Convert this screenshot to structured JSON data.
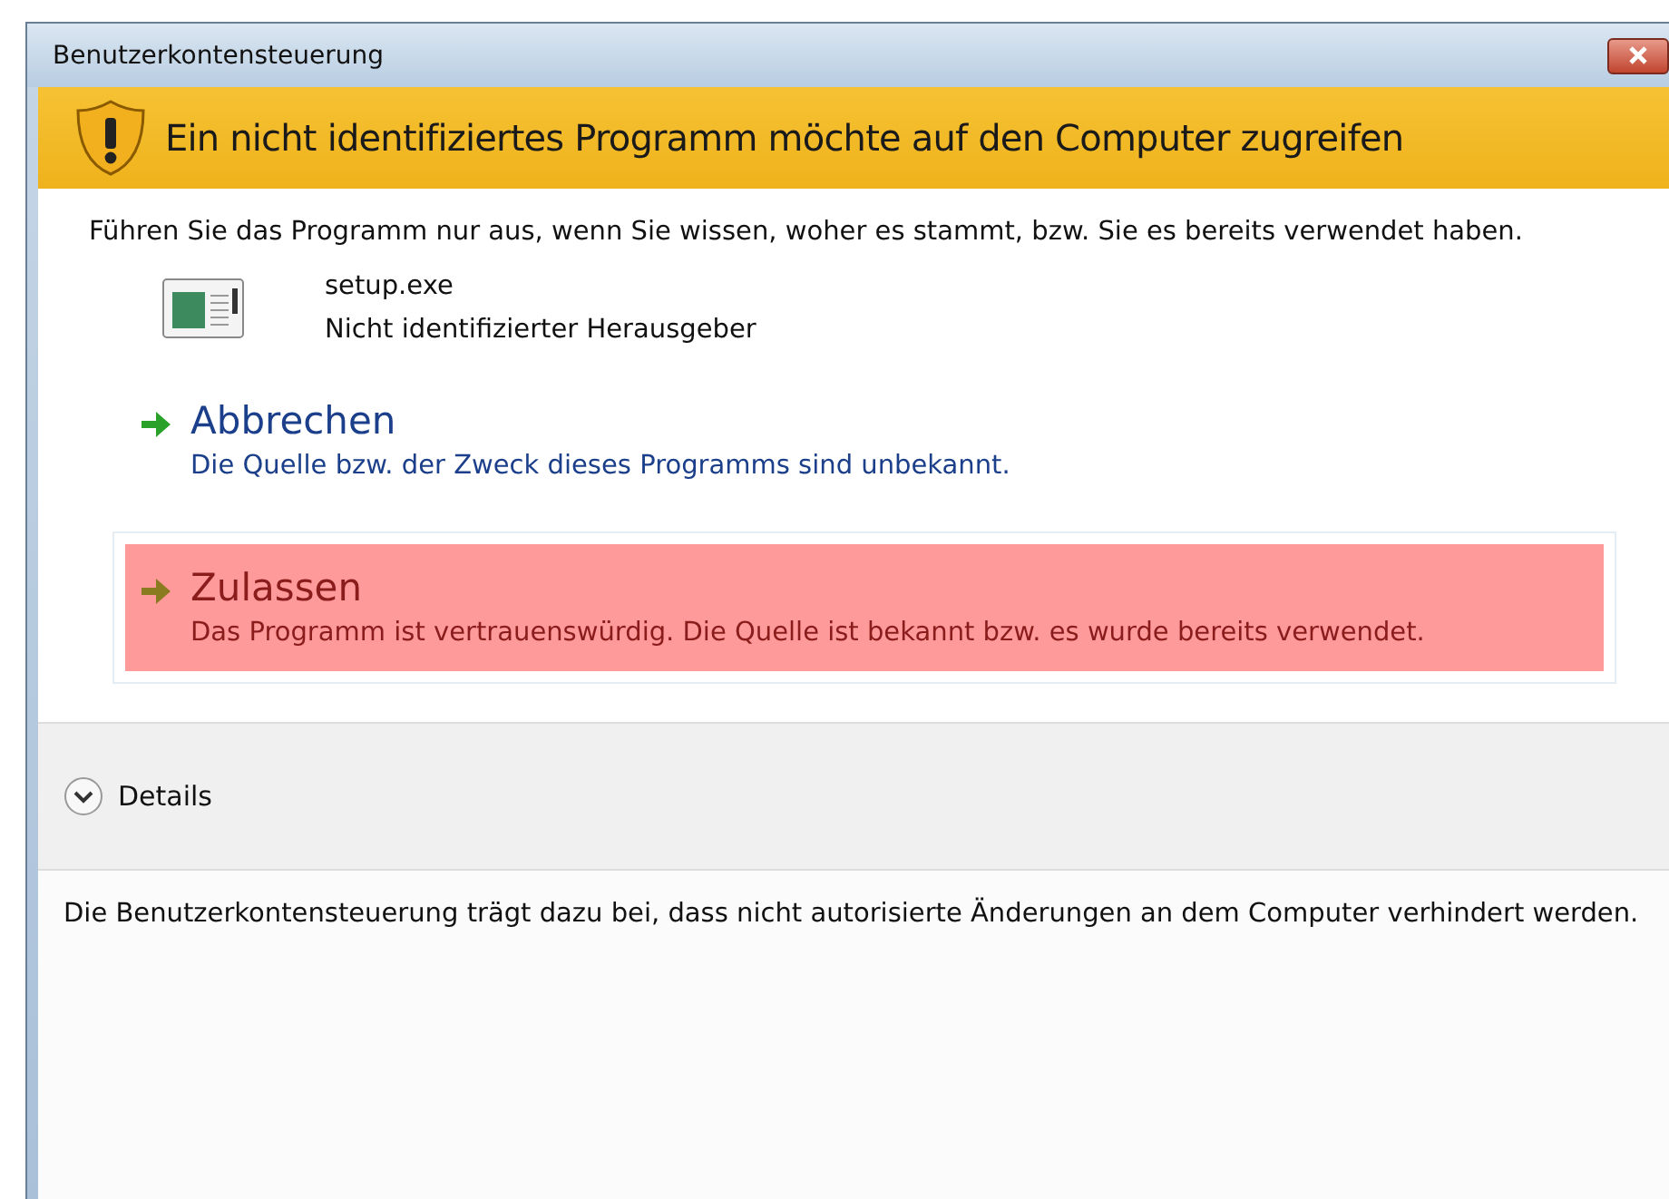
{
  "window": {
    "title": "Benutzerkontensteuerung"
  },
  "banner": {
    "text": "Ein nicht identifiziertes Programm möchte auf den Computer zugreifen"
  },
  "intro": "Führen Sie das Programm nur aus, wenn Sie wissen, woher es stammt, bzw. Sie es bereits verwendet haben.",
  "program": {
    "name": "setup.exe",
    "publisher": "Nicht identifizierter Herausgeber"
  },
  "options": [
    {
      "title": "Abbrechen",
      "description": "Die Quelle bzw. der Zweck dieses Programms sind unbekannt.",
      "selected": false
    },
    {
      "title": "Zulassen",
      "description": "Das Programm ist vertrauenswürdig. Die Quelle ist bekannt bzw. es wurde bereits verwendet.",
      "selected": true
    }
  ],
  "details": {
    "label": "Details"
  },
  "footer": "Die Benutzerkontensteuerung trägt dazu bei, dass nicht autorisierte Änderungen an dem Computer verhindert werden."
}
